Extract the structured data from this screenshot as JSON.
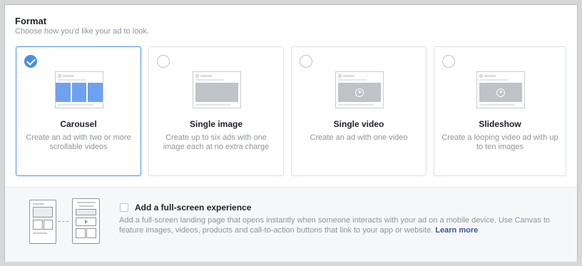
{
  "format": {
    "title": "Format",
    "subtitle": "Choose how you'd like your ad to look."
  },
  "cards": [
    {
      "title": "Carousel",
      "description": "Create an ad with two or more scrollable videos",
      "selected": true,
      "thumbnail_icon": "carousel-thumbnail-icon"
    },
    {
      "title": "Single image",
      "description": "Create up to six ads with one image each at no extra charge",
      "selected": false,
      "thumbnail_icon": "single-image-thumbnail-icon"
    },
    {
      "title": "Single video",
      "description": "Create an ad with one video",
      "selected": false,
      "thumbnail_icon": "single-video-thumbnail-icon"
    },
    {
      "title": "Slideshow",
      "description": "Create a looping video ad with up to ten images",
      "selected": false,
      "thumbnail_icon": "slideshow-thumbnail-icon"
    }
  ],
  "fullscreen": {
    "checked": false,
    "title": "Add a full-screen experience",
    "description": "Add a full-screen landing page that opens instantly when someone interacts with your ad on a mobile device. Use Canvas to feature images, videos, products and call-to-action buttons that link to your app or website.",
    "link_text": "Learn more"
  },
  "colors": {
    "accent": "#4a90e2",
    "carousel_panel": "#6fa1ee",
    "link": "#365899"
  }
}
